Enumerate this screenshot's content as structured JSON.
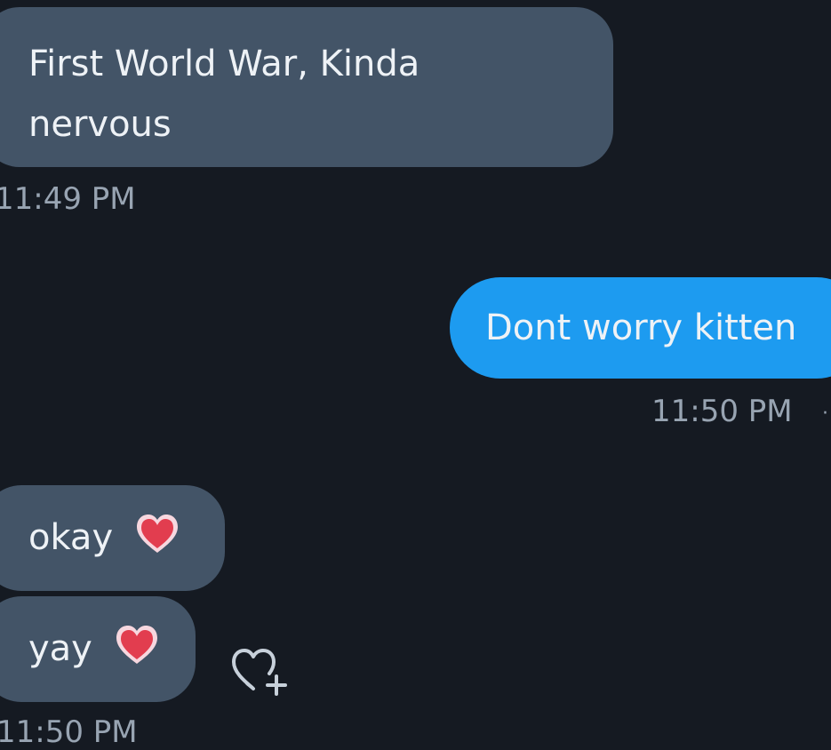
{
  "messages": [
    {
      "direction": "incoming",
      "lines": [
        "First World War, Kinda",
        "nervous"
      ]
    },
    {
      "direction": "outgoing",
      "text": "Dont worry kitten"
    },
    {
      "direction": "incoming",
      "text": "okay",
      "emoji": "heart-icon"
    },
    {
      "direction": "incoming",
      "text": "yay",
      "emoji": "heart-icon"
    }
  ],
  "timestamps": {
    "first": "11:49 PM",
    "second": "11:50 PM",
    "third": "11:50 PM"
  },
  "reactions": {
    "add_reaction_icon": "heart-plus-icon"
  },
  "colors": {
    "background": "#151a22",
    "incoming_bubble": "#435467",
    "outgoing_bubble": "#1d9bf0",
    "timestamp_text": "#98a4b2",
    "heart": "#e23d4f"
  }
}
